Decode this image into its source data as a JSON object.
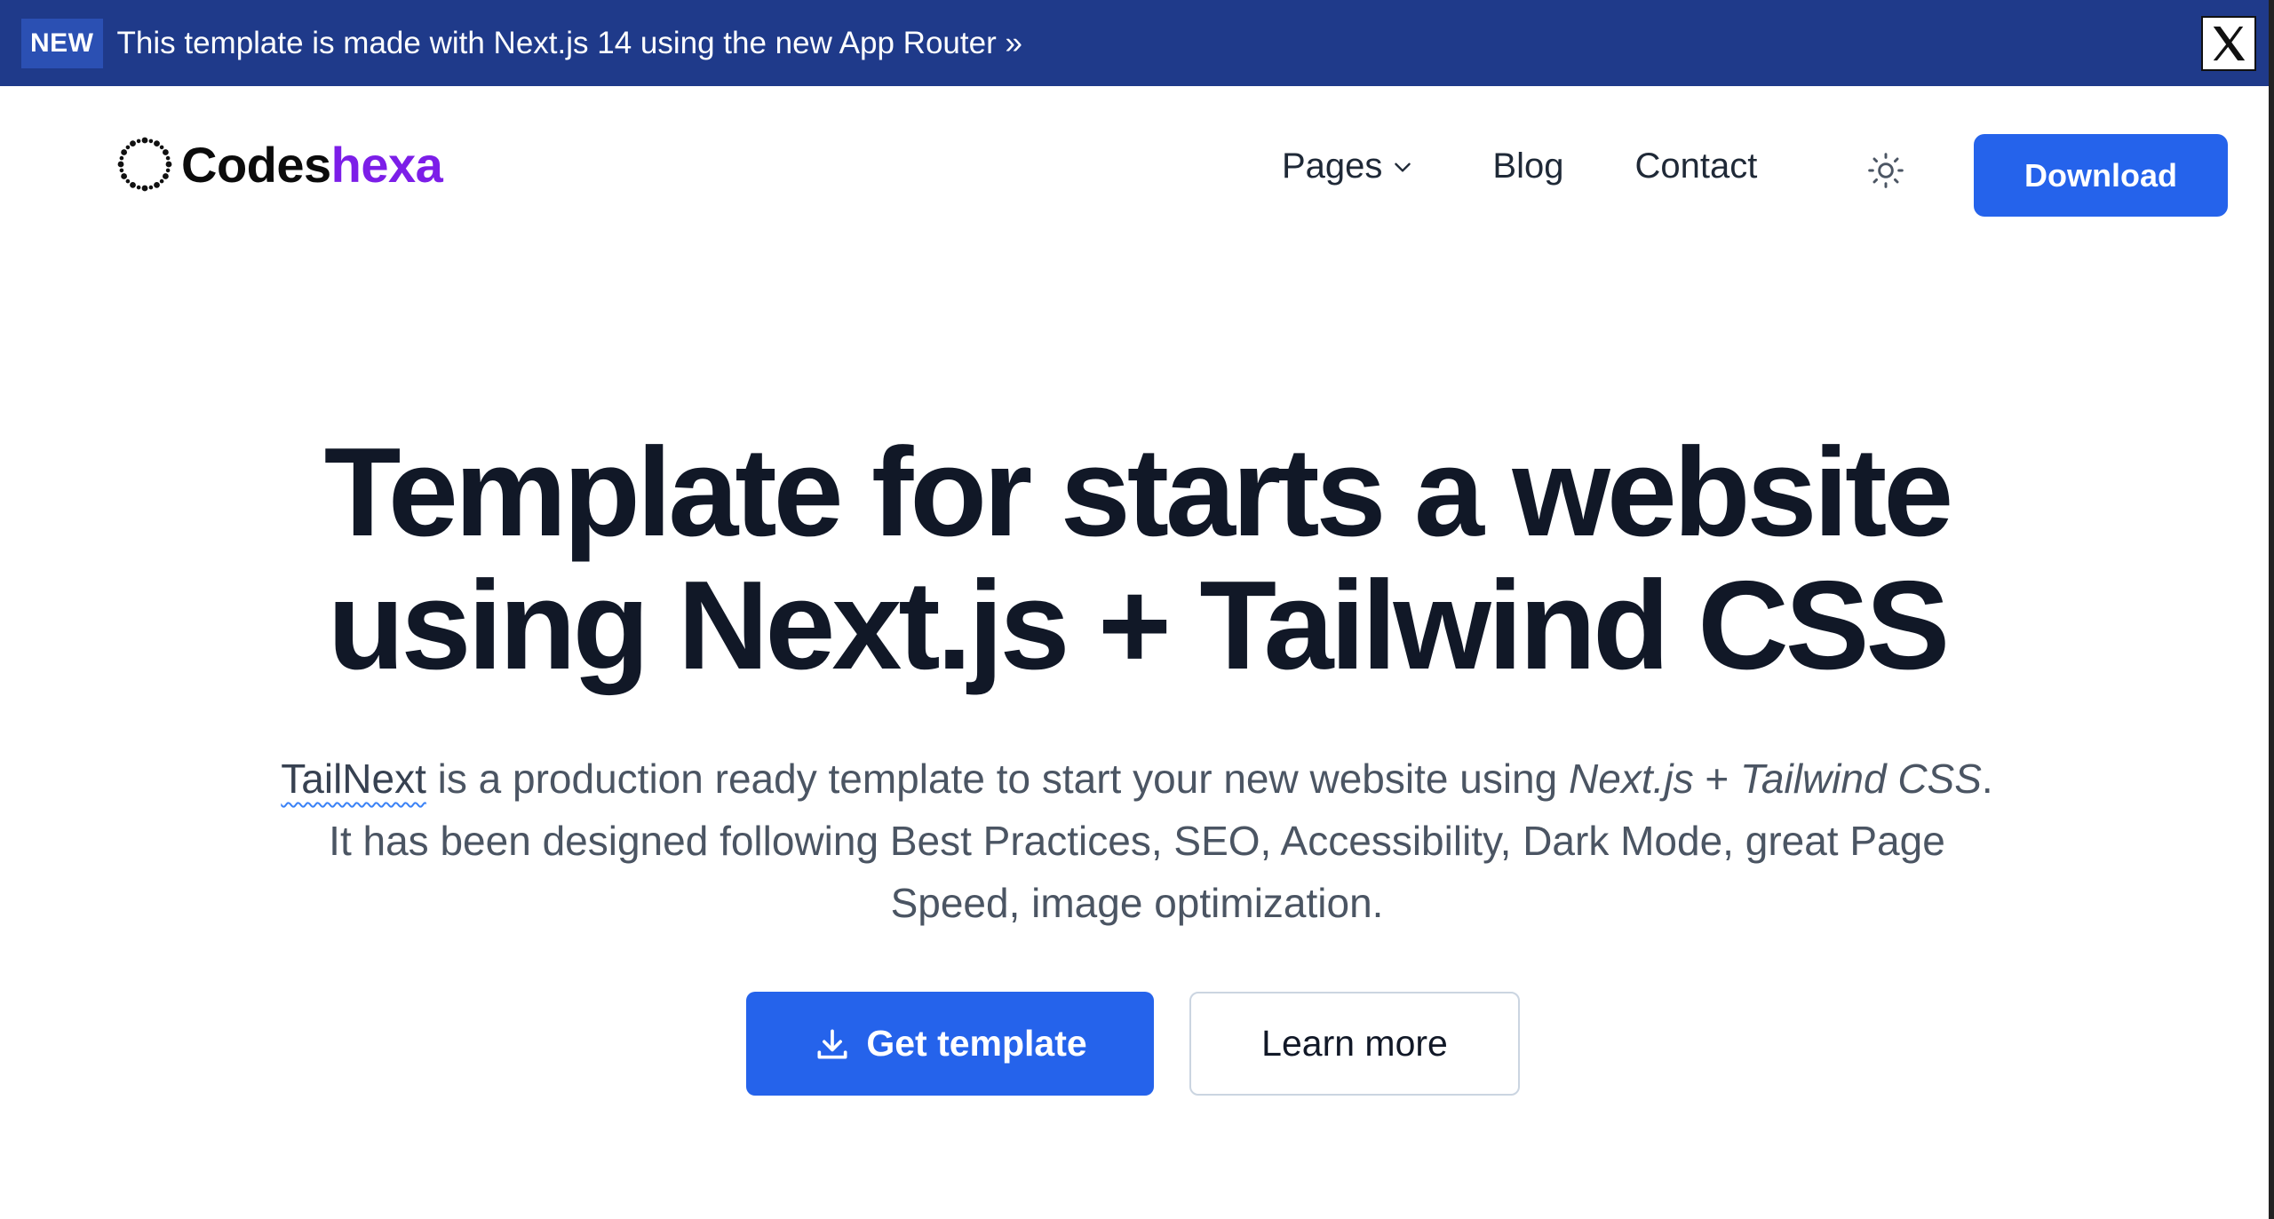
{
  "announcement": {
    "badge": "NEW",
    "text": "This template is made with Next.js 14 using the new App Router »",
    "close_icon": "x-close-icon"
  },
  "header": {
    "logo": {
      "part1": "Codes",
      "part2": "hexa",
      "icon": "dotted-circle-logo-icon"
    },
    "nav": {
      "pages": "Pages",
      "blog": "Blog",
      "contact": "Contact"
    },
    "theme_icon": "sun-icon",
    "download": "Download"
  },
  "hero": {
    "title_line1": "Template for starts a website",
    "title_line2": "using Next.js + Tailwind CSS",
    "subtitle": {
      "brand": "TailNext",
      "part1": " is a production ready template to start your new website using ",
      "em1": "Next.js",
      "part2": " + ",
      "em2": "Tailwind CSS",
      "part3": ". It has been designed following Best Practices, SEO, Accessibility, Dark Mode, great Page Speed, image optimization."
    },
    "primary_cta": "Get template",
    "secondary_cta": "Learn more"
  },
  "colors": {
    "announcement_bg": "#1f3a8a",
    "accent": "#2563eb",
    "brand_purple": "#7c1ee8",
    "heading": "#111827",
    "body_text": "#4b5563"
  }
}
